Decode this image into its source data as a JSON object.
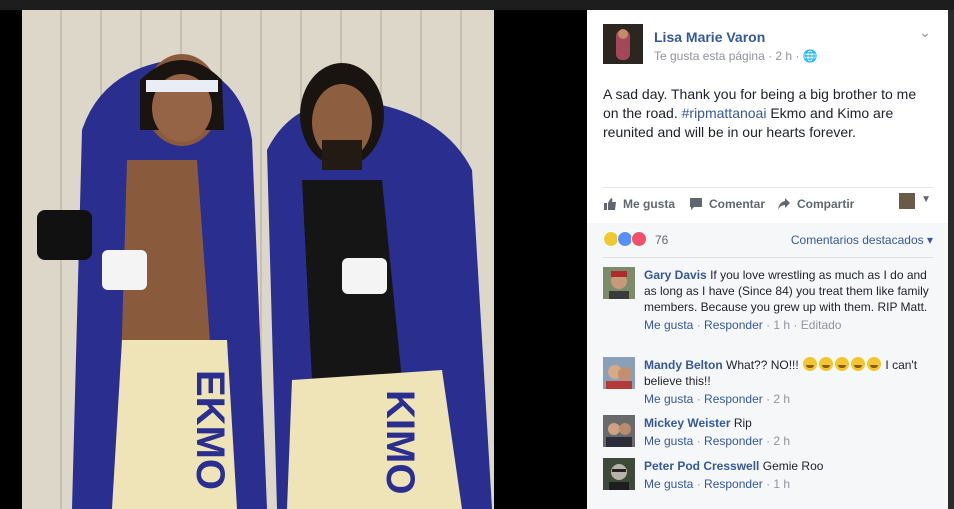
{
  "post": {
    "author": "Lisa Marie Varon",
    "meta_prefix": "Te gusta esta página",
    "meta_time": "2 h",
    "text_before": "A sad day. Thank you for being a big brother to me on the road. ",
    "hashtag": "#ripmattanoai",
    "text_after": " Ekmo and Kimo are reunited and will be in our hearts forever."
  },
  "actions": {
    "like": "Me gusta",
    "comment": "Comentar",
    "share": "Compartir"
  },
  "reactions": {
    "count": "76",
    "sort_label": "Comentarios destacados",
    "types": [
      "sad",
      "like",
      "love"
    ]
  },
  "comments": [
    {
      "name": "Gary Davis",
      "text": "If you love wrestling as much as I do and as long as I have (Since 84) you treat them like family members. Because you grew up with them. RIP Matt.",
      "like": "Me gusta",
      "reply": "Responder",
      "time": "1 h",
      "edited": "Editado"
    },
    {
      "name": "Mandy Belton",
      "text_before": "What?? NO!!!",
      "text_after": "I can't believe this!!",
      "emoji_count": 5,
      "like": "Me gusta",
      "reply": "Responder",
      "time": "2 h"
    },
    {
      "name": "Mickey Weister",
      "text": "Rip",
      "like": "Me gusta",
      "reply": "Responder",
      "time": "2 h"
    },
    {
      "name": "Peter Pod Cresswell",
      "text": "Gemie Roo",
      "like": "Me gusta",
      "reply": "Responder",
      "time": "1 h"
    }
  ],
  "photo": {
    "left_trunks": "EKMO",
    "right_trunks": "KIMO"
  },
  "colors": {
    "link": "#365899",
    "meta": "#90949c",
    "outfit_blue": "#2a2f8f"
  }
}
